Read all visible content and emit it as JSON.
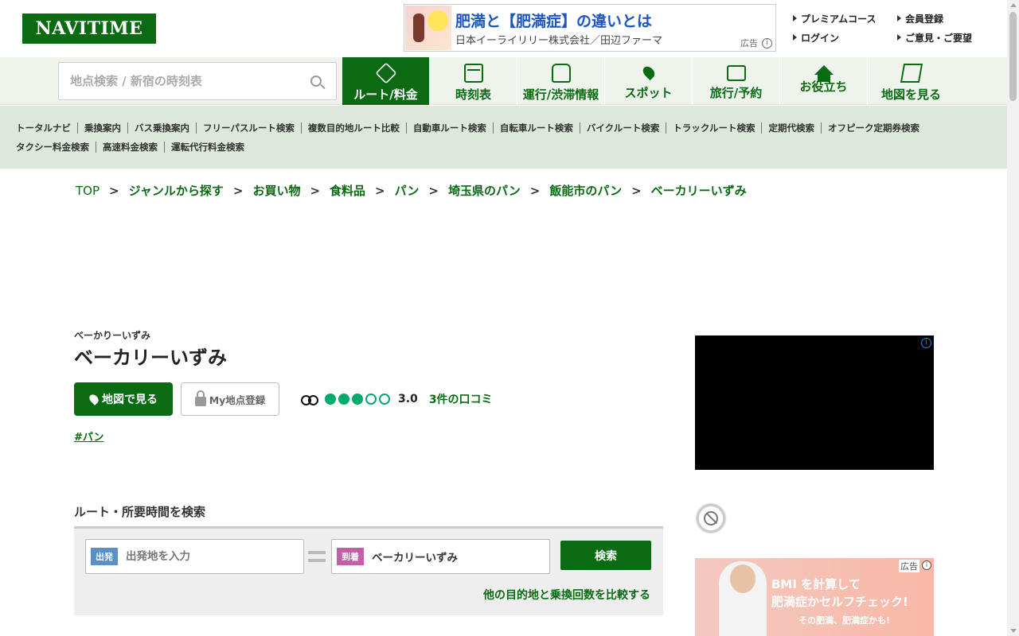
{
  "header": {
    "logo": "NAVITIME",
    "ad": {
      "headline": "肥満と【肥満症】の違いとは",
      "advertiser": "日本イーライリリー株式会社／田辺ファーマ",
      "label": "広告"
    },
    "links": [
      "プレミアムコース",
      "会員登録",
      "ログイン",
      "ご意見・ご要望"
    ]
  },
  "nav": {
    "search_placeholder": "地点検索 / 新宿の時刻表",
    "tabs": [
      {
        "label": "ルート/料金",
        "icon": "route-icon",
        "active": true
      },
      {
        "label": "時刻表",
        "icon": "timetable-icon"
      },
      {
        "label": "運行/渋滞情報",
        "icon": "traffic-icon"
      },
      {
        "label": "スポット",
        "icon": "spot-pin-icon"
      },
      {
        "label": "旅行/予約",
        "icon": "travel-bag-icon"
      },
      {
        "label": "お役立ち",
        "icon": "house-icon"
      },
      {
        "label": "地図を見る",
        "icon": "map-icon"
      }
    ]
  },
  "sublinks": {
    "row1": [
      "トータルナビ",
      "乗換案内",
      "バス乗換案内",
      "フリーパスルート検索",
      "複数目的地ルート比較",
      "自動車ルート検索",
      "自転車ルート検索",
      "バイクルート検索",
      "トラックルート検索",
      "定期代検索",
      "オフピーク定期券検索"
    ],
    "row2": [
      "タクシー料金検索",
      "高速料金検索",
      "運転代行料金検索"
    ]
  },
  "breadcrumb": [
    "TOP",
    "ジャンルから探す",
    "お買い物",
    "食料品",
    "パン",
    "埼玉県のパン",
    "飯能市のパン",
    "ベーカリーいずみ"
  ],
  "breadcrumb_sep": ">",
  "place": {
    "kana": "べーかりーいずみ",
    "name": "ベーカリーいずみ",
    "map_button": "地図で見る",
    "myspot_button": "My地点登録",
    "rating": 3.0,
    "rating_text": "3.0",
    "reviews": "3件の口コミ",
    "tag": "#パン"
  },
  "route": {
    "heading": "ルート・所要時間を検索",
    "from_badge": "出発",
    "from_placeholder": "出発地を入力",
    "to_badge": "到着",
    "to_value": "ベーカリーいずみ",
    "search_button": "検索",
    "compare_link": "他の目的地と乗換回数を比較する"
  },
  "side_ad": {
    "label": "広告",
    "line1": "BMI を計算して",
    "line2": "肥満症かセルフチェック!",
    "line3": "その肥満、肥満症かも!"
  },
  "colors": {
    "brand_green": "#0a6b13",
    "nav_bg": "#eef4ec",
    "rating_green": "#00aa6c",
    "from_badge": "#5b8fc7",
    "to_badge": "#c25fa8"
  }
}
